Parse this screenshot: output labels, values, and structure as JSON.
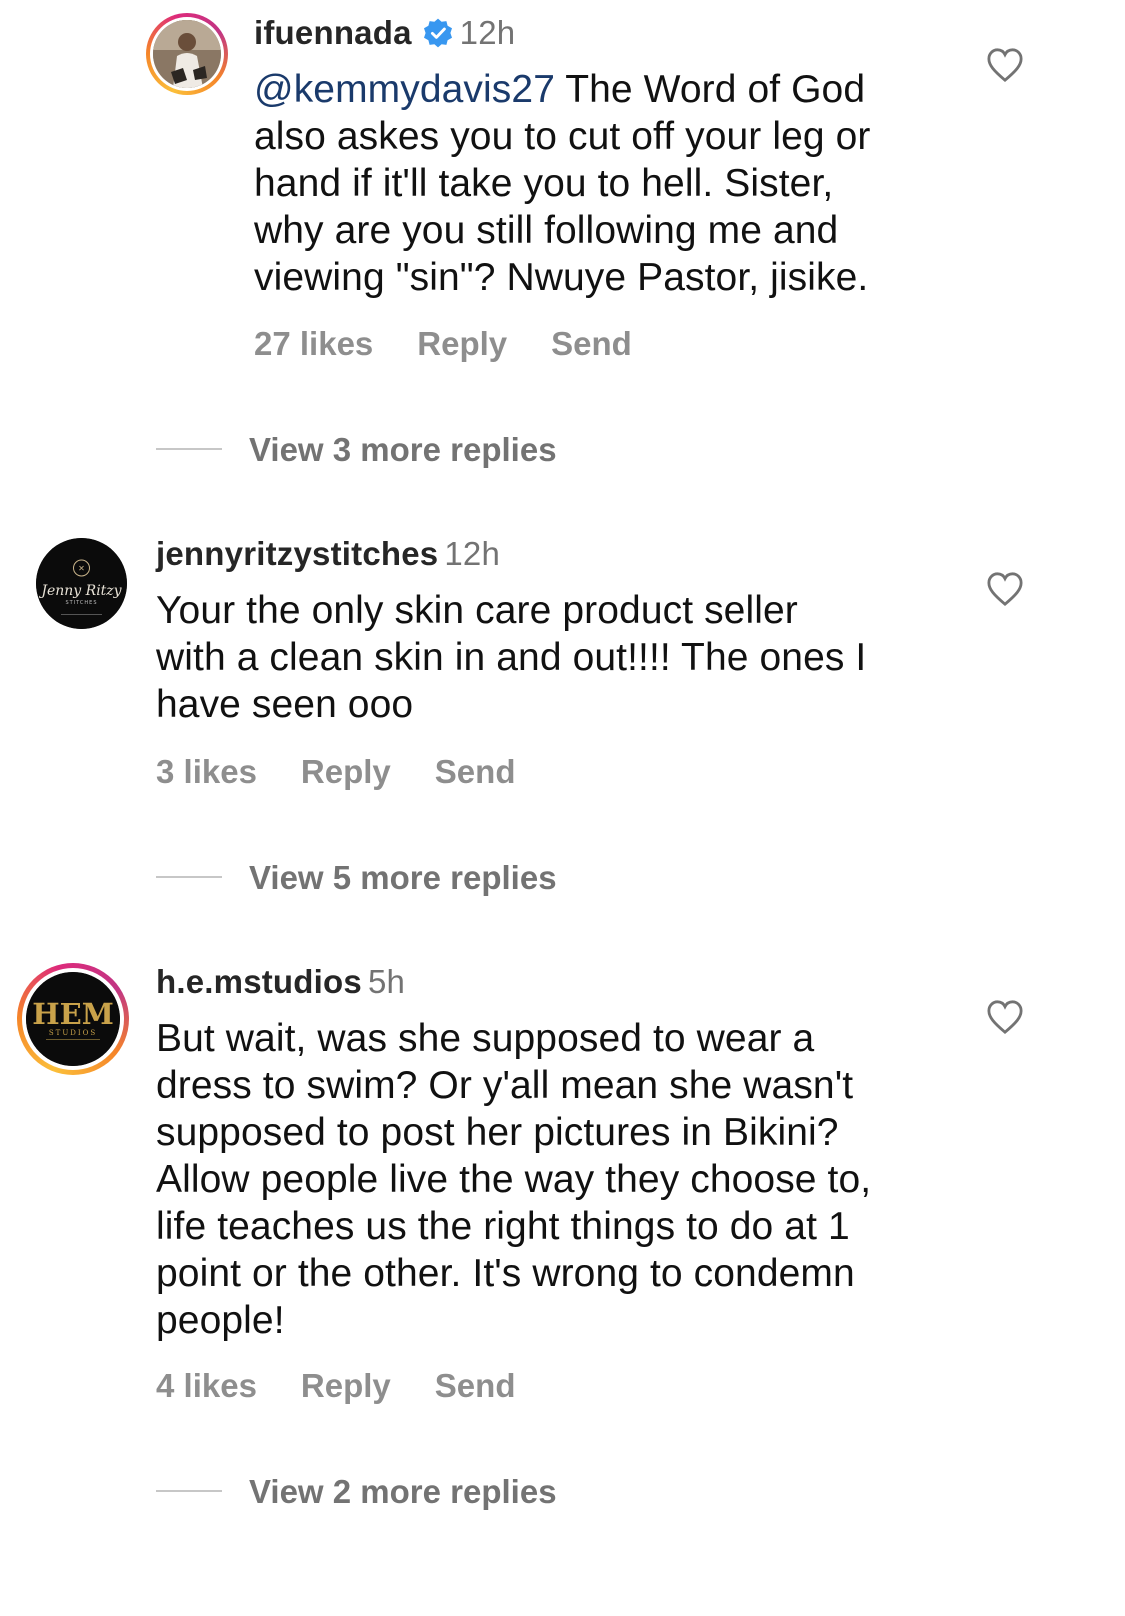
{
  "comments": [
    {
      "username": "ifuennada",
      "verified": true,
      "time": "12h",
      "mention": "@kemmydavis27",
      "text": " The Word of God\nalso askes you to cut off your leg or\nhand if it'll take you to hell. Sister,\nwhy are you still following me and\nviewing \"sin\"? Nwuye Pastor, jisike.",
      "likes": "27 likes",
      "reply": "Reply",
      "send": "Send",
      "view_more": "View 3 more replies",
      "avatar_icon": "profile-photo-avatar"
    },
    {
      "username": "jennyritzystitches",
      "verified": false,
      "time": "12h",
      "mention": "",
      "text": "Your the only skin care product seller\nwith a clean skin in and out!!!! The ones I\nhave seen ooo",
      "likes": "3 likes",
      "reply": "Reply",
      "send": "Send",
      "view_more": "View 5 more replies",
      "avatar_logo_text": "Jenny Ritzy",
      "avatar_logo_sub": "STITCHES"
    },
    {
      "username": "h.e.mstudios",
      "verified": false,
      "time": "5h",
      "mention": "",
      "text": "But wait, was she supposed to wear a\ndress to swim? Or y'all mean she wasn't\nsupposed to post her pictures in Bikini?\nAllow people live the way they choose to,\nlife teaches us the right things to do at 1\npoint or the other. It's wrong to condemn\npeople!",
      "likes": "4 likes",
      "reply": "Reply",
      "send": "Send",
      "view_more": "View 2 more replies",
      "avatar_logo_text": "HEM",
      "avatar_logo_sub": "STUDIOS"
    }
  ],
  "colors": {
    "text": "#111111",
    "meta": "#8e8e8e",
    "mention": "#1a3a6b",
    "verified": "#3897f0",
    "story_ring": "#dd2a7b"
  }
}
